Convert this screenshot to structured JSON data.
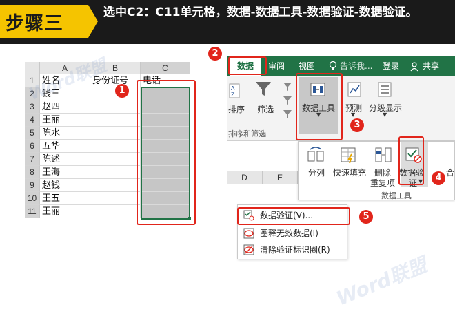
{
  "banner": {
    "step": "步骤三",
    "instruction": "选中C2：C11单元格，数据-数据工具-数据验证-数据验证。"
  },
  "sheet": {
    "columns": [
      "A",
      "B",
      "C"
    ],
    "rows": [
      {
        "num": "1",
        "a": "姓名",
        "b": "身份证号",
        "c": "电话"
      },
      {
        "num": "2",
        "a": "钱三",
        "b": "",
        "c": ""
      },
      {
        "num": "3",
        "a": "赵四",
        "b": "",
        "c": ""
      },
      {
        "num": "4",
        "a": "王丽",
        "b": "",
        "c": ""
      },
      {
        "num": "5",
        "a": "陈水",
        "b": "",
        "c": ""
      },
      {
        "num": "6",
        "a": "五华",
        "b": "",
        "c": ""
      },
      {
        "num": "7",
        "a": "陈述",
        "b": "",
        "c": ""
      },
      {
        "num": "8",
        "a": "王海",
        "b": "",
        "c": ""
      },
      {
        "num": "9",
        "a": "赵钱",
        "b": "",
        "c": ""
      },
      {
        "num": "10",
        "a": "王五",
        "b": "",
        "c": ""
      },
      {
        "num": "11",
        "a": "王丽",
        "b": "",
        "c": ""
      }
    ],
    "selection": "C2:C11"
  },
  "ribbon": {
    "tabs": [
      "数据",
      "审阅",
      "视图",
      "告诉我...",
      "登录",
      "共享"
    ],
    "buttons": {
      "sort": "排序",
      "filter": "筛选",
      "data_tools": "数据工具",
      "forecast": "预测",
      "outline": "分级显示"
    },
    "group_label": "排序和筛选"
  },
  "data_tools_panel": {
    "buttons": [
      "分列",
      "快速填充",
      "删除\n重复项",
      "数据验\n证"
    ],
    "split": "分列",
    "flash_fill": "快速填充",
    "remove_dup_1": "删除",
    "remove_dup_2": "重复项",
    "validate_1": "数据验",
    "validate_2": "证",
    "merge": "合",
    "group_label": "数据工具",
    "grid_cols": [
      "D",
      "E"
    ]
  },
  "validation_menu": {
    "items": [
      "数据验证(V)...",
      "圈释无效数据(I)",
      "清除验证标识圈(R)"
    ]
  },
  "badges": [
    "1",
    "2",
    "3",
    "4",
    "5"
  ],
  "watermark": "Word联盟",
  "colors": {
    "accent": "#e1251b",
    "excel_green": "#217346",
    "step_yellow": "#f5c400"
  }
}
